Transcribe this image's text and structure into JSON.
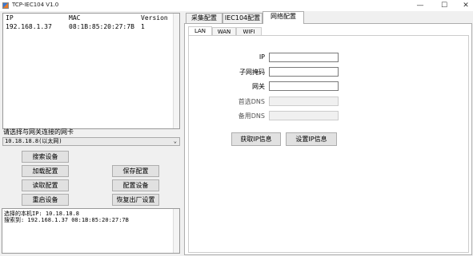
{
  "window": {
    "title": "TCP-IEC104 V1.0",
    "minimize": "—",
    "maximize": "☐",
    "close": "✕"
  },
  "device_table": {
    "columns": [
      "IP",
      "MAC",
      "Version"
    ],
    "rows": [
      [
        "192.168.1.37",
        "08:1B:85:20:27:7B",
        "1"
      ]
    ]
  },
  "nic": {
    "label": "请选择与网关连接的网卡",
    "selected": "10.18.18.8(以太网)"
  },
  "buttons": {
    "search": "搜索设备",
    "load_config": "加载配置",
    "read_config": "读取配置",
    "restart": "重启设备",
    "save_config": "保存配置",
    "configure_device": "配置设备",
    "factory_reset": "恢复出厂设置",
    "get_ip": "获取IP信息",
    "set_ip": "设置IP信息"
  },
  "log": {
    "lines": [
      "选择的本机IP: 10.18.18.8",
      "搜索到: 192.168.1.37    08:1B:85:20:27:7B"
    ]
  },
  "tabs": [
    "采集配置",
    "IEC104配置",
    "网络配置"
  ],
  "active_tab": "网络配置",
  "subtabs": [
    "LAN",
    "WAN",
    "WIFI"
  ],
  "active_subtab": "LAN",
  "network_form": {
    "ip_label": "IP",
    "ip_value": "",
    "mask_label": "子网掩码",
    "mask_value": "",
    "gateway_label": "网关",
    "gateway_value": "",
    "dns1_label": "首选DNS",
    "dns1_value": "",
    "dns2_label": "备用DNS",
    "dns2_value": ""
  }
}
